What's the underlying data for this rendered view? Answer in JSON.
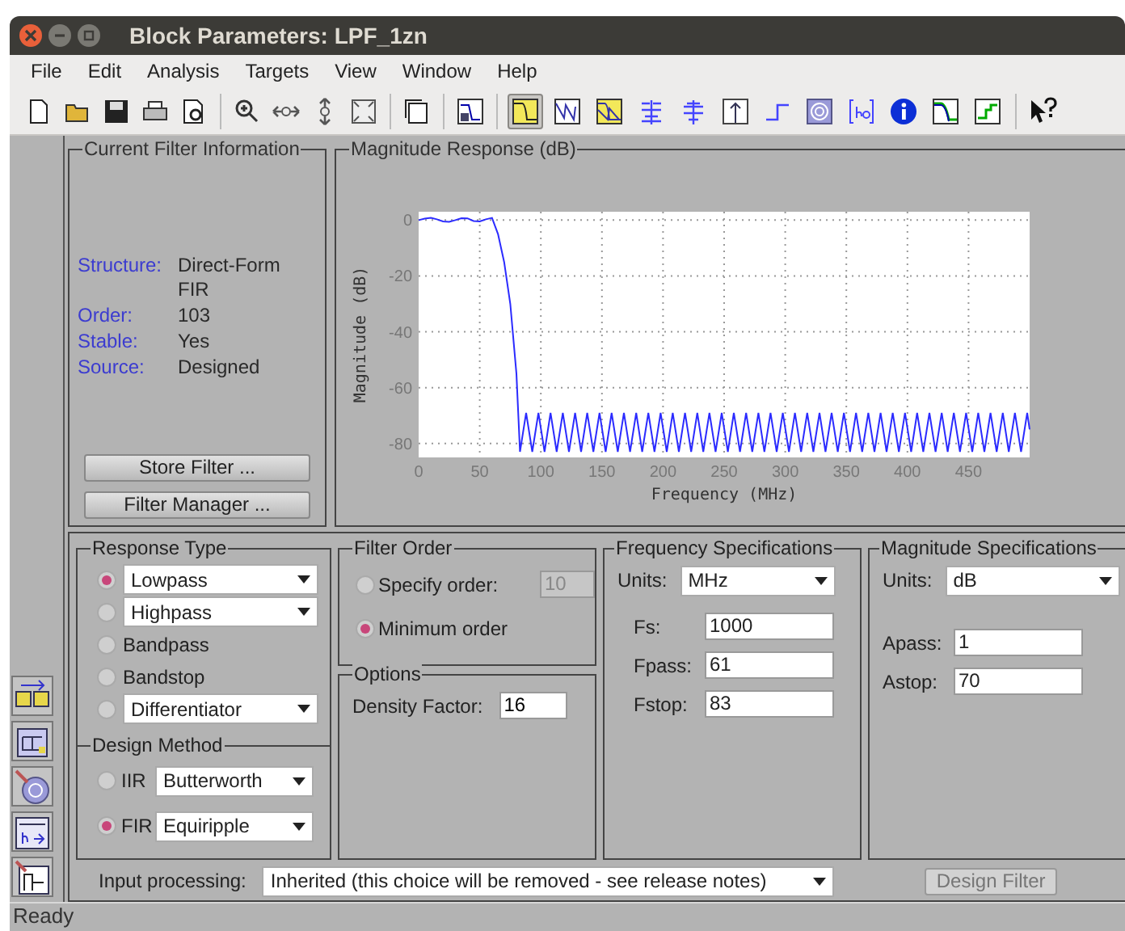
{
  "window": {
    "title": "Block Parameters: LPF_1zn"
  },
  "menu": [
    "File",
    "Edit",
    "Analysis",
    "Targets",
    "View",
    "Window",
    "Help"
  ],
  "toolbar": {
    "analysis_buttons": [
      {
        "selected": true
      },
      {
        "selected": false
      },
      {
        "selected": false
      },
      {
        "selected": false
      },
      {
        "selected": false
      },
      {
        "selected": false
      },
      {
        "selected": false
      },
      {
        "selected": false
      },
      {
        "selected": false
      },
      {
        "selected": false
      },
      {
        "selected": false
      },
      {
        "selected": false
      }
    ]
  },
  "filter_info": {
    "title": "Current Filter Information",
    "rows": [
      {
        "label": "Structure:",
        "value": "Direct-Form FIR"
      },
      {
        "label": "Order:",
        "value": "103"
      },
      {
        "label": "Stable:",
        "value": "Yes"
      },
      {
        "label": "Source:",
        "value": "Designed"
      }
    ],
    "buttons": [
      "Store Filter ...",
      "Filter Manager ..."
    ]
  },
  "magnitude_response": {
    "title": "Magnitude Response (dB)",
    "chart_data": {
      "type": "line",
      "grid": true,
      "xlabel": "Frequency (MHz)",
      "ylabel": "Magnitude (dB)",
      "xlim": [
        0,
        500
      ],
      "ylim": [
        -85,
        3
      ],
      "xticks": [
        0,
        50,
        100,
        150,
        200,
        250,
        300,
        350,
        400,
        450
      ],
      "yticks": [
        0,
        -20,
        -40,
        -60,
        -80
      ],
      "x": [
        0,
        5,
        10,
        15,
        20,
        25,
        30,
        35,
        40,
        45,
        50,
        55,
        60,
        65,
        70,
        75,
        80,
        83,
        88,
        93,
        98,
        103,
        108,
        113,
        118,
        123,
        128,
        133,
        138,
        143,
        148,
        153,
        158,
        163,
        168,
        173,
        178,
        183,
        188,
        193,
        198,
        203,
        208,
        213,
        218,
        223,
        228,
        233,
        238,
        243,
        248,
        253,
        258,
        263,
        268,
        273,
        278,
        283,
        288,
        293,
        298,
        303,
        308,
        313,
        318,
        323,
        328,
        333,
        338,
        343,
        348,
        353,
        358,
        363,
        368,
        373,
        378,
        383,
        388,
        393,
        398,
        403,
        408,
        413,
        418,
        423,
        428,
        433,
        438,
        443,
        448,
        453,
        458,
        463,
        468,
        473,
        478,
        483,
        488,
        493,
        498,
        500
      ],
      "series": [
        {
          "color": "#2b2bff",
          "values": [
            0,
            0.5,
            0.8,
            0.3,
            -0.5,
            -0.6,
            0,
            0.7,
            0.6,
            -0.3,
            -0.5,
            0.3,
            0.8,
            -5,
            -15,
            -30,
            -55,
            -83,
            -69,
            -83,
            -69,
            -83,
            -69,
            -83,
            -69,
            -83,
            -69,
            -83,
            -69,
            -83,
            -69,
            -83,
            -69,
            -83,
            -69,
            -83,
            -69,
            -83,
            -69,
            -83,
            -69,
            -83,
            -69,
            -83,
            -69,
            -83,
            -69,
            -83,
            -69,
            -83,
            -69,
            -83,
            -69,
            -83,
            -69,
            -83,
            -69,
            -83,
            -69,
            -83,
            -69,
            -83,
            -69,
            -83,
            -69,
            -83,
            -69,
            -83,
            -69,
            -83,
            -69,
            -83,
            -69,
            -83,
            -69,
            -83,
            -69,
            -83,
            -69,
            -83,
            -69,
            -83,
            -69,
            -83,
            -69,
            -83,
            -69,
            -83,
            -69,
            -83,
            -69,
            -83,
            -69,
            -83,
            -69,
            -83,
            -69,
            -83,
            -69,
            -83,
            -69,
            -75
          ]
        }
      ]
    }
  },
  "response_type": {
    "title": "Response Type",
    "options": [
      {
        "label": "Lowpass",
        "selected": true,
        "kind": "dropdown"
      },
      {
        "label": "Highpass",
        "selected": false,
        "kind": "dropdown"
      },
      {
        "label": "Bandpass",
        "selected": false,
        "kind": "plain"
      },
      {
        "label": "Bandstop",
        "selected": false,
        "kind": "plain"
      },
      {
        "label": "Differentiator",
        "selected": false,
        "kind": "dropdown"
      }
    ]
  },
  "design_method": {
    "title": "Design Method",
    "options": [
      {
        "label": "IIR",
        "selected": false,
        "value": "Butterworth"
      },
      {
        "label": "FIR",
        "selected": true,
        "value": "Equiripple"
      }
    ]
  },
  "filter_order": {
    "title": "Filter Order",
    "options": [
      {
        "label": "Specify order:",
        "selected": false,
        "value": "10"
      },
      {
        "label": "Minimum order",
        "selected": true
      }
    ]
  },
  "options": {
    "title": "Options",
    "label": "Density Factor:",
    "value": "16"
  },
  "frequency_specs": {
    "title": "Frequency Specifications",
    "units_label": "Units:",
    "units": "MHz",
    "fields": [
      {
        "label": "Fs:",
        "value": "1000"
      },
      {
        "label": "Fpass:",
        "value": "61"
      },
      {
        "label": "Fstop:",
        "value": "83"
      }
    ]
  },
  "magnitude_specs": {
    "title": "Magnitude Specifications",
    "units_label": "Units:",
    "units": "dB",
    "fields": [
      {
        "label": "Apass:",
        "value": "1"
      },
      {
        "label": "Astop:",
        "value": "70"
      }
    ]
  },
  "input_processing": {
    "label": "Input processing:",
    "value": "Inherited (this choice will be removed - see release notes)"
  },
  "design_button": {
    "label": "Design Filter",
    "disabled": true
  },
  "status_bar": "Ready"
}
